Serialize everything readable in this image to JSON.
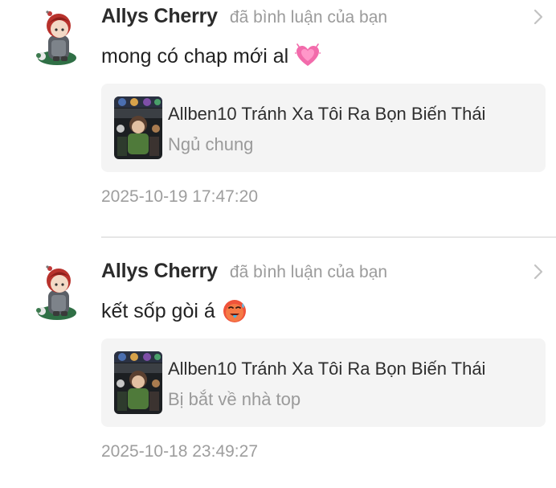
{
  "notifications": [
    {
      "username": "Allys Cherry",
      "action": "đã bình luận của bạn",
      "comment": "mong có chap mới al",
      "emoji_icon": "pink-heart-icon",
      "story_title": "Allben10 Tránh Xa Tôi Ra Bọn Biến Thái",
      "chapter": "Ngủ chung",
      "timestamp": "2025-10-19 17:47:20"
    },
    {
      "username": "Allys Cherry",
      "action": "đã bình luận của bạn",
      "comment": "kết sốp gòi á",
      "emoji_icon": "hot-face-icon",
      "story_title": "Allben10 Tránh Xa Tôi Ra Bọn Biến Thái",
      "chapter": "Bị bắt về nhà top",
      "timestamp": "2025-10-18 23:49:27"
    }
  ],
  "colors": {
    "card_background": "#f4f4f4",
    "muted_text": "#9e9e9e",
    "divider": "#e6e6e6"
  }
}
